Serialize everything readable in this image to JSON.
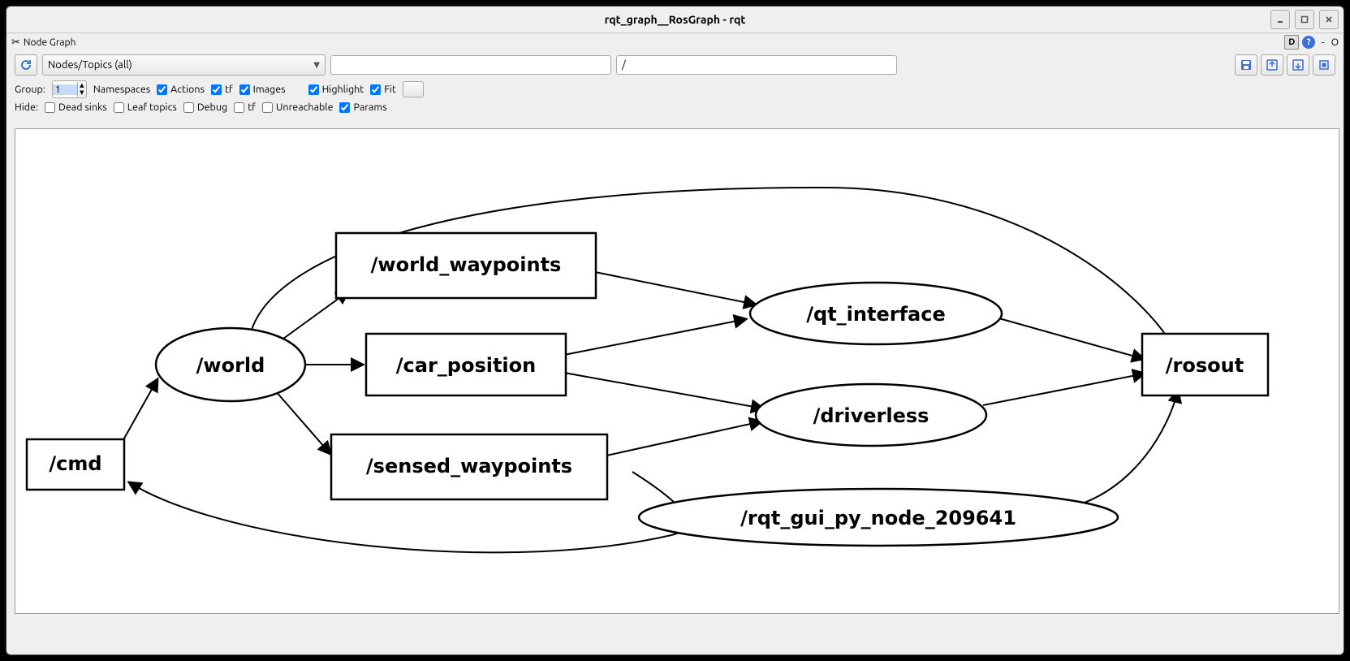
{
  "window": {
    "title": "rqt_graph__RosGraph - rqt"
  },
  "dock": {
    "title": "Node Graph",
    "d": "D",
    "q": "?",
    "dash": "-",
    "undock": "O"
  },
  "toolbar": {
    "dropdown_label": "Nodes/Topics (all)",
    "filter1": "",
    "filter2": "/"
  },
  "group_row": {
    "label_group": "Group:",
    "spin_value": "1",
    "namespaces": "Namespaces",
    "actions": "Actions",
    "tf": "tf",
    "images": "Images",
    "highlight": "Highlight",
    "fit": "Fit"
  },
  "hide_row": {
    "label_hide": "Hide:",
    "deadsinks": "Dead sinks",
    "leaftopics": "Leaf topics",
    "debug": "Debug",
    "tf": "tf",
    "unreachable": "Unreachable",
    "params": "Params"
  },
  "graph": {
    "nodes": {
      "world": "/world",
      "qt": "/qt_interface",
      "driverless": "/driverless",
      "rqtgui": "/rqt_gui_py_node_209641"
    },
    "topics": {
      "cmd": "/cmd",
      "wwp": "/world_waypoints",
      "cpos": "/car_position",
      "swp": "/sensed_waypoints",
      "rosout": "/rosout"
    }
  }
}
